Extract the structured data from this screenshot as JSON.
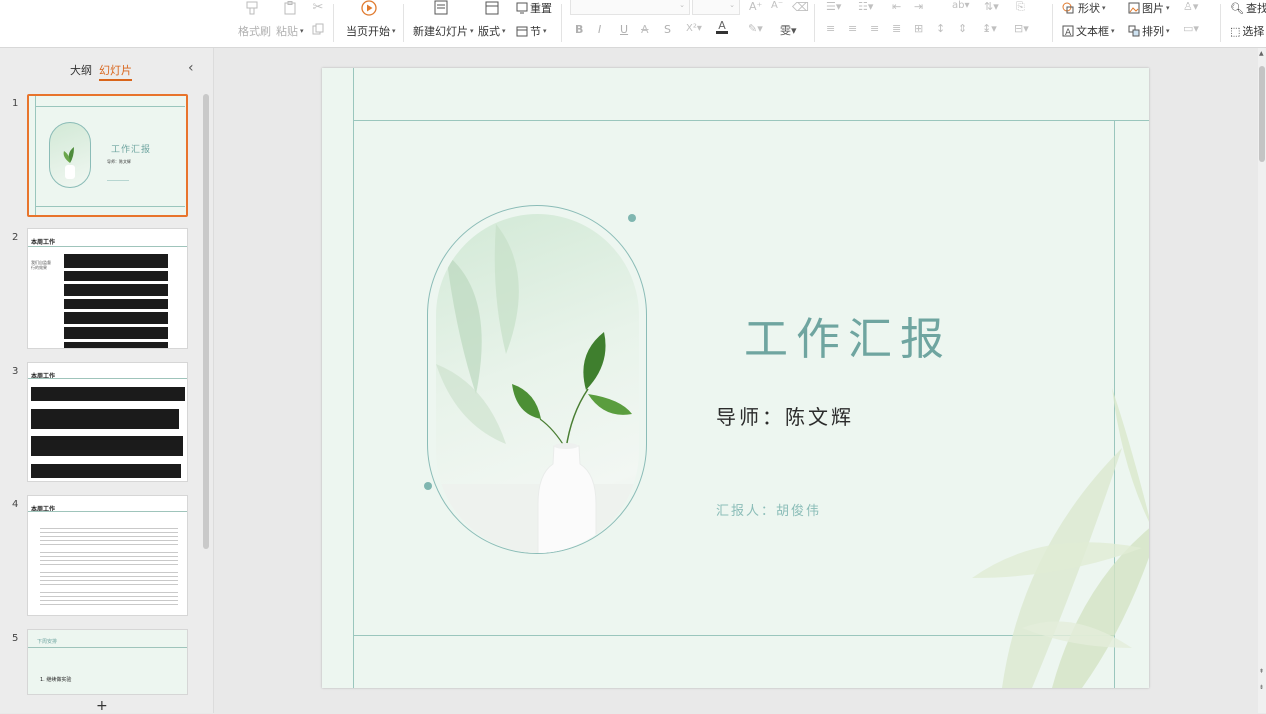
{
  "ribbon": {
    "clipboard": {
      "format_painter": "格式刷",
      "paste": "粘贴"
    },
    "slideshow": {
      "play_from_current": "当页开始"
    },
    "slides": {
      "new_slide": "新建幻灯片",
      "layout": "版式",
      "section": "节",
      "reset": "重置"
    },
    "font": {
      "family": "",
      "size": "",
      "bold": "B",
      "italic": "I",
      "underline": "U",
      "strike": "S"
    },
    "insert": {
      "shape": "形状",
      "picture": "图片",
      "textbox": "文本框",
      "arrange": "排列"
    },
    "editing": {
      "find": "查找",
      "select": "选择"
    }
  },
  "left_panel": {
    "tabs": [
      {
        "label": "大纲"
      },
      {
        "label": "幻灯片"
      }
    ],
    "thumbnails": [
      {
        "number": "1",
        "title": "工作汇报",
        "advisor": "导师：陈文辉"
      },
      {
        "number": "2",
        "title": "本周工作",
        "caption": "我们自监督行的效果"
      },
      {
        "number": "3",
        "title": "本周工作"
      },
      {
        "number": "4",
        "title": "本周工作"
      },
      {
        "number": "5",
        "title": "下周安排",
        "item": "1. 继续做实验"
      }
    ]
  },
  "slide": {
    "title": "工作汇报",
    "advisor": "导师：陈文辉",
    "reporter": "汇报人：胡俊伟"
  },
  "colors": {
    "accent": "#e8742c",
    "slide_bg": "#edf6f0",
    "title_teal": "#6fa5a0",
    "frame_line": "#9ac6bd"
  }
}
